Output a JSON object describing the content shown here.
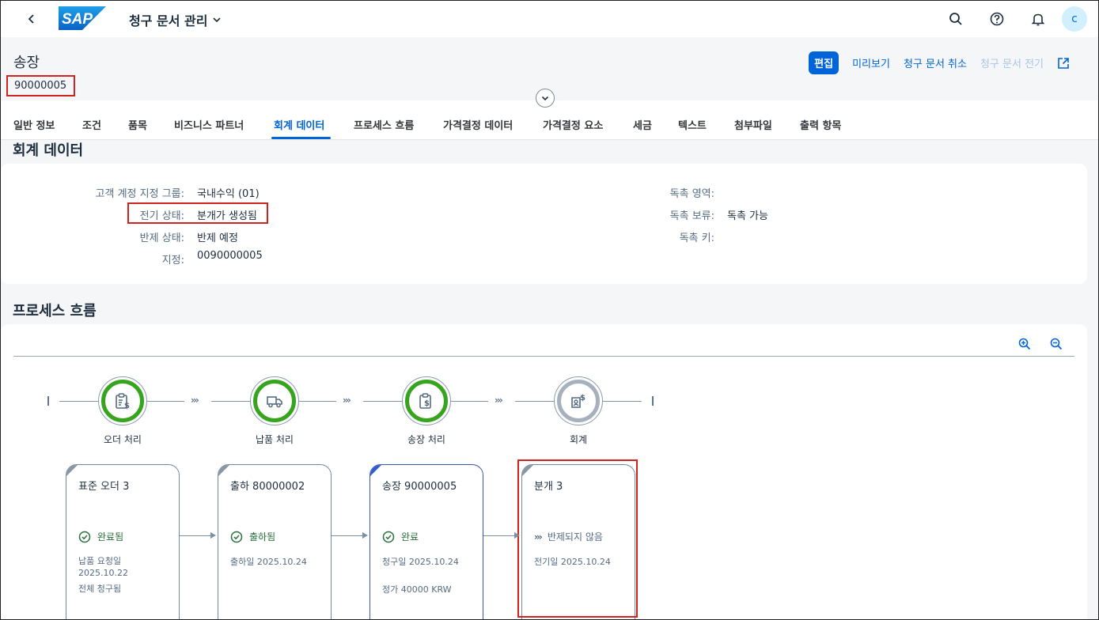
{
  "shell": {
    "app_title": "청구 문서 관리",
    "avatar_initial": "C",
    "logo_text": "SAP"
  },
  "header": {
    "object_type": "송장",
    "object_number": "90000005",
    "actions": {
      "edit": "편집",
      "preview": "미리보기",
      "cancel": "청구 문서 취소",
      "post": "청구 문서 전기"
    }
  },
  "tabs": [
    "일반 정보",
    "조건",
    "품목",
    "비즈니스 파트너",
    "회계 데이터",
    "프로세스 흐름",
    "가격결정 데이터",
    "가격결정 요소",
    "세금",
    "텍스트",
    "첨부파일",
    "출력 항목"
  ],
  "active_tab_index": 4,
  "accounting": {
    "section_title": "회계 데이터",
    "fields_left": [
      {
        "label": "고객 계정 지정 그룹:",
        "value": "국내수익 (01)"
      },
      {
        "label": "전기 상태:",
        "value": "분개가 생성됨"
      },
      {
        "label": "반제 상태:",
        "value": "반제 예정"
      },
      {
        "label": "지정:",
        "value": "0090000005"
      }
    ],
    "fields_right": [
      {
        "label": "독촉 영역:",
        "value": ""
      },
      {
        "label": "독촉 보류:",
        "value": "독촉 가능"
      },
      {
        "label": "독촉 키:",
        "value": ""
      }
    ]
  },
  "process_flow": {
    "section_title": "프로세스 흐름",
    "lanes": [
      {
        "label": "오더 처리",
        "icon": "clipboard-dollar-icon",
        "state": "done"
      },
      {
        "label": "납품 처리",
        "icon": "truck-icon",
        "state": "done"
      },
      {
        "label": "송장 처리",
        "icon": "invoice-icon",
        "state": "done"
      },
      {
        "label": "회계",
        "icon": "accounting-icon",
        "state": "pending"
      }
    ],
    "nodes": [
      {
        "title": "표준 오더 3",
        "status": "완료됨",
        "status_icon": "check-circle-icon",
        "meta": [
          "납품 요청일",
          "2025.10.22",
          "전체 청구됨"
        ]
      },
      {
        "title": "출하 80000002",
        "status": "출하됨",
        "status_icon": "check-circle-icon",
        "meta": [
          "출하일 2025.10.24"
        ]
      },
      {
        "title": "송장 90000005",
        "status": "완료",
        "status_icon": "check-circle-icon",
        "meta": [
          "청구일 2025.10.24",
          "정가 40000 KRW"
        ]
      },
      {
        "title": "분개 3",
        "status": "반제되지 않음",
        "status_icon": "chevrons-right-icon",
        "meta": [
          "전기일 2025.10.24"
        ]
      }
    ]
  },
  "colors": {
    "brand": "#0064d9",
    "success": "#36a41d",
    "highlight": "#d0251f"
  }
}
